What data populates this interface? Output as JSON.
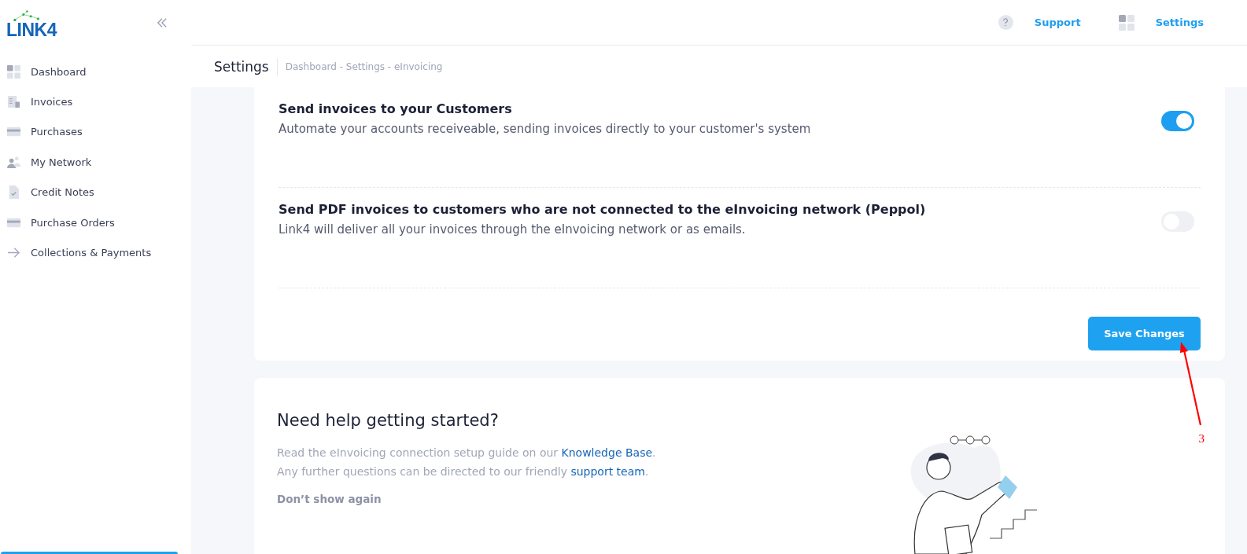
{
  "logo": "LINK4",
  "sidebar": {
    "items": [
      {
        "label": "Dashboard",
        "kind": "grid"
      },
      {
        "label": "Invoices",
        "kind": "invoice"
      },
      {
        "label": "Purchases",
        "kind": "card"
      },
      {
        "label": "My Network",
        "kind": "people"
      },
      {
        "label": "Credit Notes",
        "kind": "note"
      },
      {
        "label": "Purchase Orders",
        "kind": "card"
      },
      {
        "label": "Collections & Payments",
        "kind": "arrow"
      }
    ]
  },
  "header": {
    "links": [
      {
        "label": "Support",
        "kind": "help"
      },
      {
        "label": "Settings",
        "kind": "grid"
      }
    ]
  },
  "page": {
    "title": "Settings",
    "breadcrumb": "Dashboard - Settings - eInvoicing"
  },
  "options": [
    {
      "title": "Send invoices to your Customers",
      "description": "Automate your accounts receiveable, sending invoices directly to your customer's system",
      "on": true
    },
    {
      "title": "Send PDF invoices to customers who are not connected to the eInvoicing network (Peppol)",
      "description": "Link4 will deliver all your invoices through the eInvoicing network or as emails.",
      "on": false
    }
  ],
  "save_button": "Save Changes",
  "annotation": {
    "label": "3"
  },
  "help": {
    "title": "Need help getting started?",
    "lines": [
      {
        "before": "Read the eInvoicing connection setup guide on our ",
        "link": "Knowledge Base",
        "after": "."
      },
      {
        "before": "Any further questions can be directed to our friendly ",
        "link": "support team",
        "after": "."
      }
    ],
    "dismiss": "Don’t show again",
    "kind": "picture"
  }
}
